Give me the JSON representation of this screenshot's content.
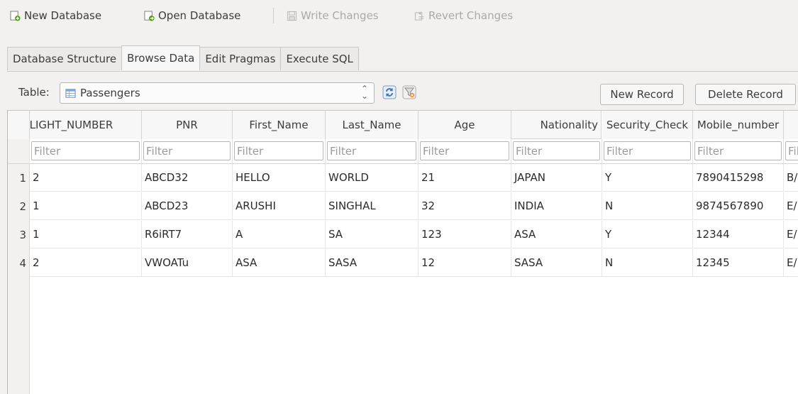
{
  "toolbar": {
    "new_database": "New Database",
    "open_database": "Open Database",
    "write_changes": "Write Changes",
    "revert_changes": "Revert Changes"
  },
  "tabs": [
    {
      "label": "Database Structure",
      "active": false
    },
    {
      "label": "Browse Data",
      "active": true
    },
    {
      "label": "Edit Pragmas",
      "active": false
    },
    {
      "label": "Execute SQL",
      "active": false
    }
  ],
  "browse": {
    "table_label": "Table:",
    "selected_table": "Passengers",
    "new_record": "New Record",
    "delete_record": "Delete Record"
  },
  "grid": {
    "filter_placeholder": "Filter",
    "columns": [
      "FLIGHT_NUMBER",
      "PNR",
      "First_Name",
      "Last_Name",
      "Age",
      "Nationality",
      "Security_Check",
      "Mobile_number"
    ],
    "rows": [
      {
        "num": "1",
        "cells": [
          "2",
          "ABCD32",
          "HELLO",
          "WORLD",
          "21",
          "JAPAN",
          "Y",
          "7890415298",
          "B/"
        ]
      },
      {
        "num": "2",
        "cells": [
          "1",
          "ABCD23",
          "ARUSHI",
          "SINGHAL",
          "32",
          "INDIA",
          "N",
          "9874567890",
          "E/"
        ]
      },
      {
        "num": "3",
        "cells": [
          "1",
          "R6iRT7",
          "A",
          "SA",
          "123",
          "ASA",
          "Y",
          "12344",
          "E/"
        ]
      },
      {
        "num": "4",
        "cells": [
          "2",
          "VWOATu",
          "ASA",
          "SASA",
          "12",
          "SASA",
          "N",
          "12345",
          "E/"
        ]
      }
    ]
  },
  "icons": {
    "new_database": "new-database-icon",
    "open_database": "open-database-icon",
    "write_changes": "write-changes-icon",
    "revert_changes": "revert-changes-icon",
    "table": "table-icon",
    "refresh": "refresh-icon",
    "clear_filters": "clear-filters-icon"
  }
}
